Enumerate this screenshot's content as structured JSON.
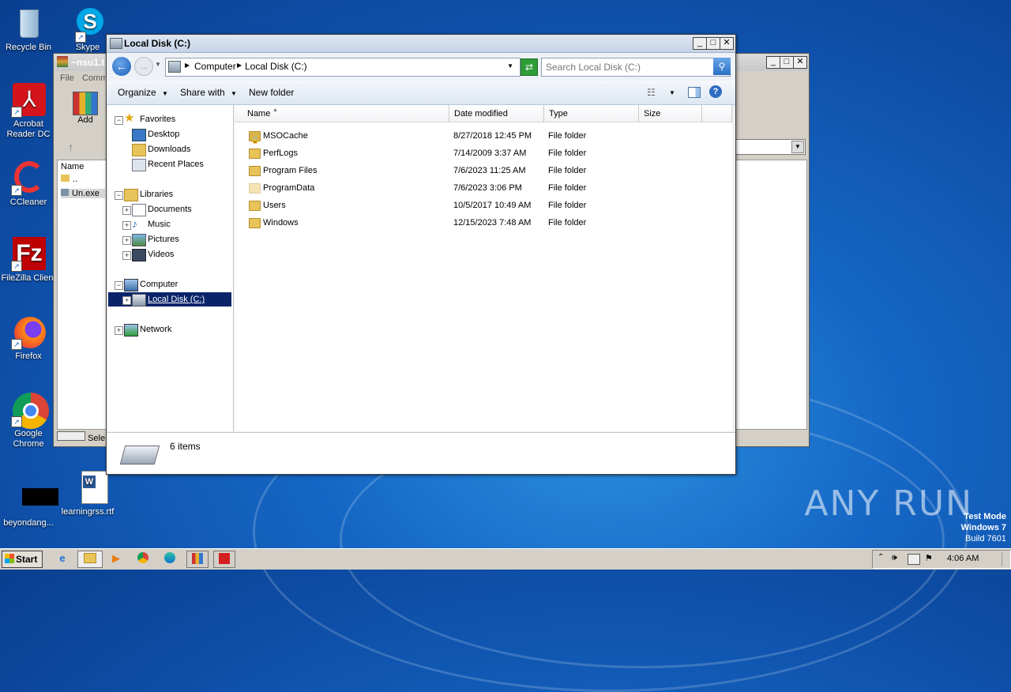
{
  "desktop": {
    "icons": [
      {
        "name": "recycle-bin",
        "label": "Recycle Bin"
      },
      {
        "name": "skype",
        "label": "Skype"
      },
      {
        "name": "acrobat",
        "label": "Acrobat Reader DC"
      },
      {
        "name": "ccleaner",
        "label": "CCleaner"
      },
      {
        "name": "filezilla",
        "label": "FileZilla Client"
      },
      {
        "name": "firefox",
        "label": "Firefox"
      },
      {
        "name": "chrome",
        "label": "Google Chrome"
      },
      {
        "name": "beyondang",
        "label": "beyondang..."
      },
      {
        "name": "learningrss",
        "label": "learningrss.rtf"
      }
    ],
    "watermark": "ANY RUN",
    "test_mode": {
      "line1": "Test Mode",
      "line2": "Windows 7",
      "line3": "Build 7601"
    }
  },
  "bg_window": {
    "title": "~nsu1.t",
    "menu_file": "File",
    "menu_comm": "Comm",
    "add_label": "Add",
    "col_name": "Name",
    "row_up": "..",
    "row_file": "Un.exe",
    "status_sel": "Sele"
  },
  "explorer": {
    "title": "Local Disk (C:)",
    "breadcrumb": [
      "Computer",
      "Local Disk (C:)"
    ],
    "search_placeholder": "Search Local Disk (C:)",
    "commands": {
      "organize": "Organize",
      "share": "Share with",
      "new_folder": "New folder"
    },
    "nav": {
      "favorites": "Favorites",
      "desktop": "Desktop",
      "downloads": "Downloads",
      "recent": "Recent Places",
      "libraries": "Libraries",
      "documents": "Documents",
      "music": "Music",
      "pictures": "Pictures",
      "videos": "Videos",
      "computer": "Computer",
      "localdisk": "Local Disk (C:)",
      "network": "Network"
    },
    "columns": {
      "name": "Name",
      "date": "Date modified",
      "type": "Type",
      "size": "Size"
    },
    "files": [
      {
        "name": "MSOCache",
        "date": "8/27/2018 12:45 PM",
        "type": "File folder"
      },
      {
        "name": "PerfLogs",
        "date": "7/14/2009 3:37 AM",
        "type": "File folder"
      },
      {
        "name": "Program Files",
        "date": "7/6/2023 11:25 AM",
        "type": "File folder"
      },
      {
        "name": "ProgramData",
        "date": "7/6/2023 3:06 PM",
        "type": "File folder"
      },
      {
        "name": "Users",
        "date": "10/5/2017 10:49 AM",
        "type": "File folder"
      },
      {
        "name": "Windows",
        "date": "12/15/2023 7:48 AM",
        "type": "File folder"
      }
    ],
    "status_count": "6 items"
  },
  "taskbar": {
    "start": "Start",
    "clock": "4:06 AM"
  }
}
